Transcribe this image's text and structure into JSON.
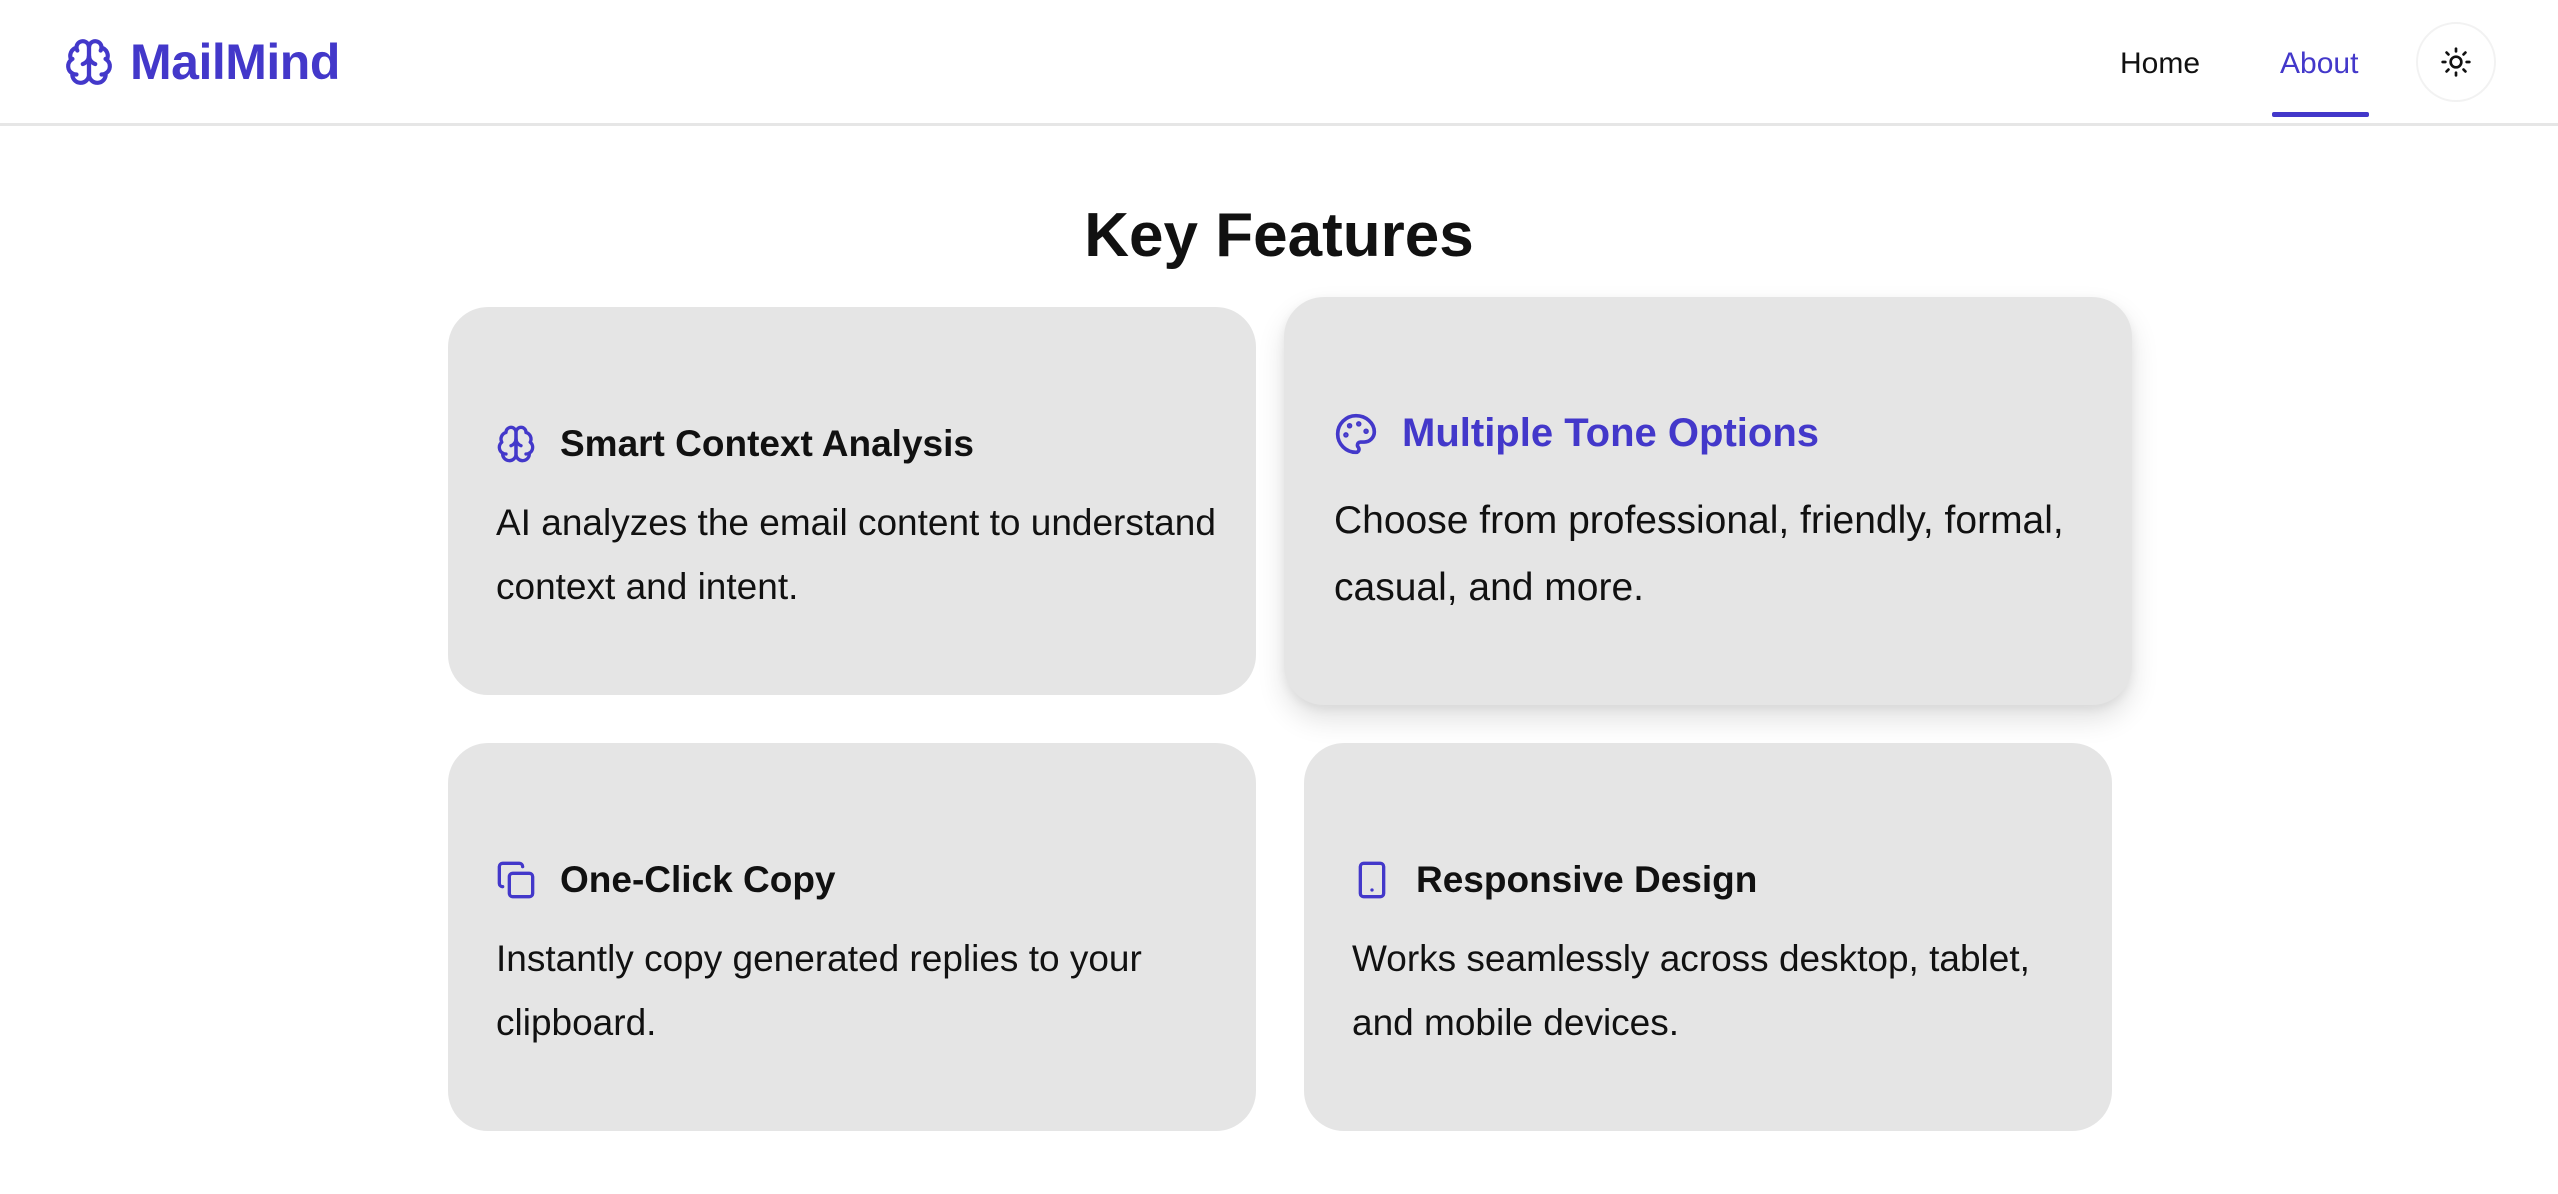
{
  "header": {
    "brand": {
      "name": "MailMind",
      "icon": "brain-icon"
    },
    "nav": [
      {
        "label": "Home",
        "active": false
      },
      {
        "label": "About",
        "active": true
      }
    ],
    "theme_toggle": {
      "icon": "sun-icon"
    }
  },
  "main": {
    "title": "Key Features",
    "features": [
      {
        "icon": "brain-icon",
        "title": "Smart Context Analysis",
        "description": "AI analyzes the email content to understand context and intent.",
        "highlighted": false
      },
      {
        "icon": "palette-icon",
        "title": "Multiple Tone Options",
        "description": "Choose from professional, friendly, formal, casual, and more.",
        "highlighted": true
      },
      {
        "icon": "copy-icon",
        "title": "One-Click Copy",
        "description": "Instantly copy generated replies to your clipboard.",
        "highlighted": false
      },
      {
        "icon": "smartphone-icon",
        "title": "Responsive Design",
        "description": "Works seamlessly across desktop, tablet, and mobile devices.",
        "highlighted": false
      }
    ]
  },
  "colors": {
    "accent": "#4338ca",
    "card_background": "#e5e5e5",
    "text": "#111111",
    "page_background": "#ffffff"
  }
}
